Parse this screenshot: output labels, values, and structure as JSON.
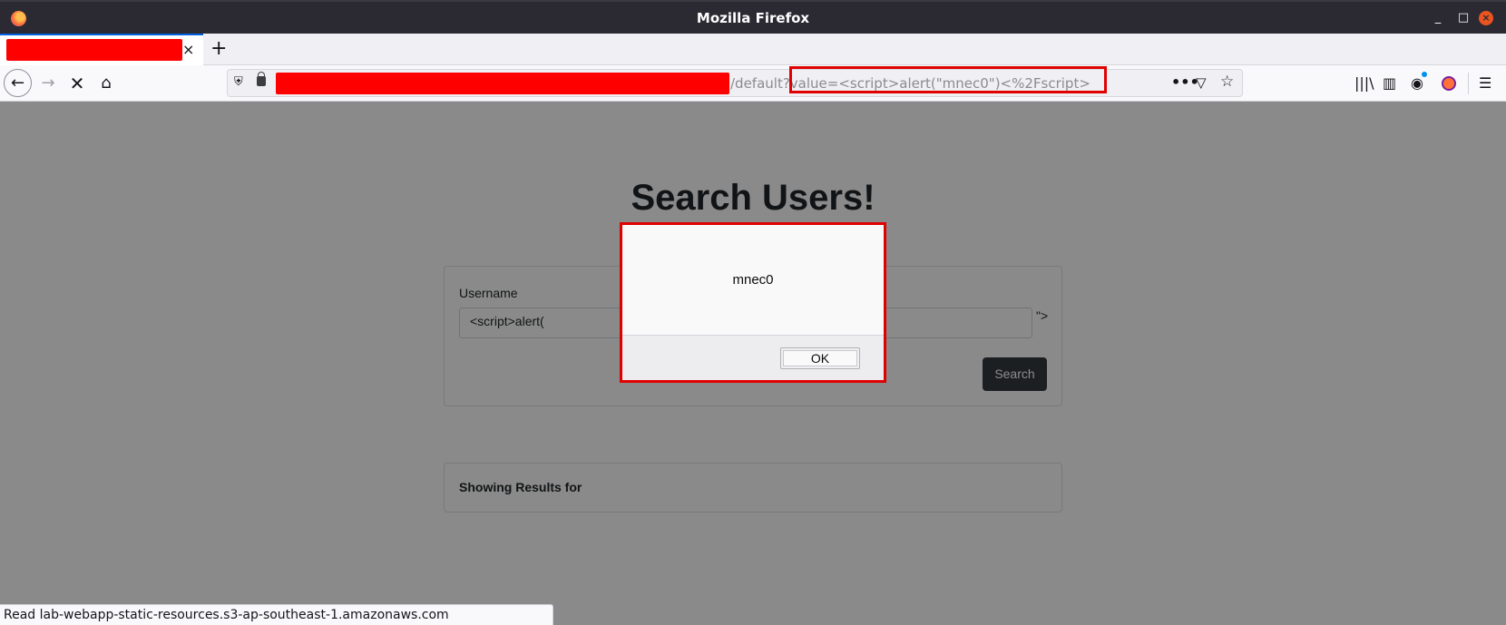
{
  "window": {
    "title": "Mozilla Firefox",
    "minimize_glyph": "_",
    "maximize_glyph": "□",
    "close_glyph": "×"
  },
  "tabs": [
    {
      "label_redacted": true,
      "close_glyph": "×"
    }
  ],
  "new_tab_glyph": "+",
  "nav": {
    "back_glyph": "←",
    "forward_glyph": "→",
    "stop_glyph": "✕",
    "home_glyph": "⌂"
  },
  "urlbar": {
    "host_redacted": true,
    "visible_url": "/default?value=<script>alert(\"mnec0\")<%2Fscript>",
    "highlighted_part": "value=<script>alert(\"mnec0\")<%2Fscript>",
    "page_actions_glyph": "•••",
    "pocket_glyph": "▽",
    "bookmark_glyph": "☆"
  },
  "toolbar": {
    "library_glyph": "|||\\",
    "sidebar_glyph": "▥",
    "account_glyph": "◉",
    "menu_glyph": "☰"
  },
  "page": {
    "title": "Search Users!",
    "username_label": "Username",
    "username_value": "<script>alert(",
    "leaked_markup": "\">",
    "search_button": "Search",
    "results_label": "Showing Results for"
  },
  "dialog": {
    "message": "mnec0",
    "ok_label": "OK"
  },
  "status": {
    "text": "Read lab-webapp-static-resources.s3-ap-southeast-1.amazonaws.com"
  },
  "colors": {
    "redaction": "#ff0000",
    "highlight_box": "#e00000",
    "titlebar": "#2b2a33",
    "button_dark": "#343a40"
  }
}
